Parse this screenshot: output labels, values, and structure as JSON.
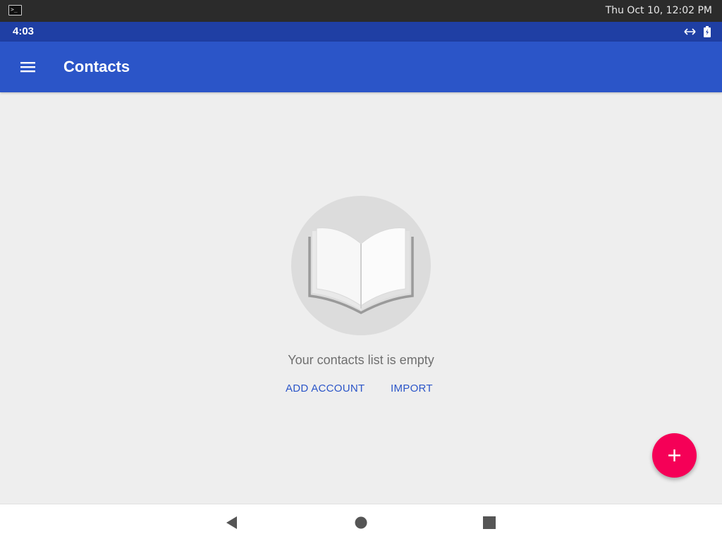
{
  "host": {
    "clock": "Thu Oct 10, 12:02 PM",
    "terminal_icon_glyph": ">_"
  },
  "status_bar": {
    "time": "4:03",
    "icons": [
      "data-transfer-icon",
      "battery-charging-icon"
    ]
  },
  "app_bar": {
    "title": "Contacts",
    "menu_icon": "hamburger-menu-icon"
  },
  "empty_state": {
    "illustration": "open-book-icon",
    "message": "Your contacts list is empty",
    "add_account_label": "ADD ACCOUNT",
    "import_label": "IMPORT"
  },
  "fab": {
    "icon": "plus-icon",
    "color": "#f50057"
  },
  "nav_bar": {
    "buttons": [
      "back-icon",
      "home-icon",
      "recents-icon"
    ]
  },
  "colors": {
    "status_bar": "#1f3fa4",
    "app_bar": "#2b55c8",
    "accent": "#f50057",
    "background": "#eeeeee"
  }
}
